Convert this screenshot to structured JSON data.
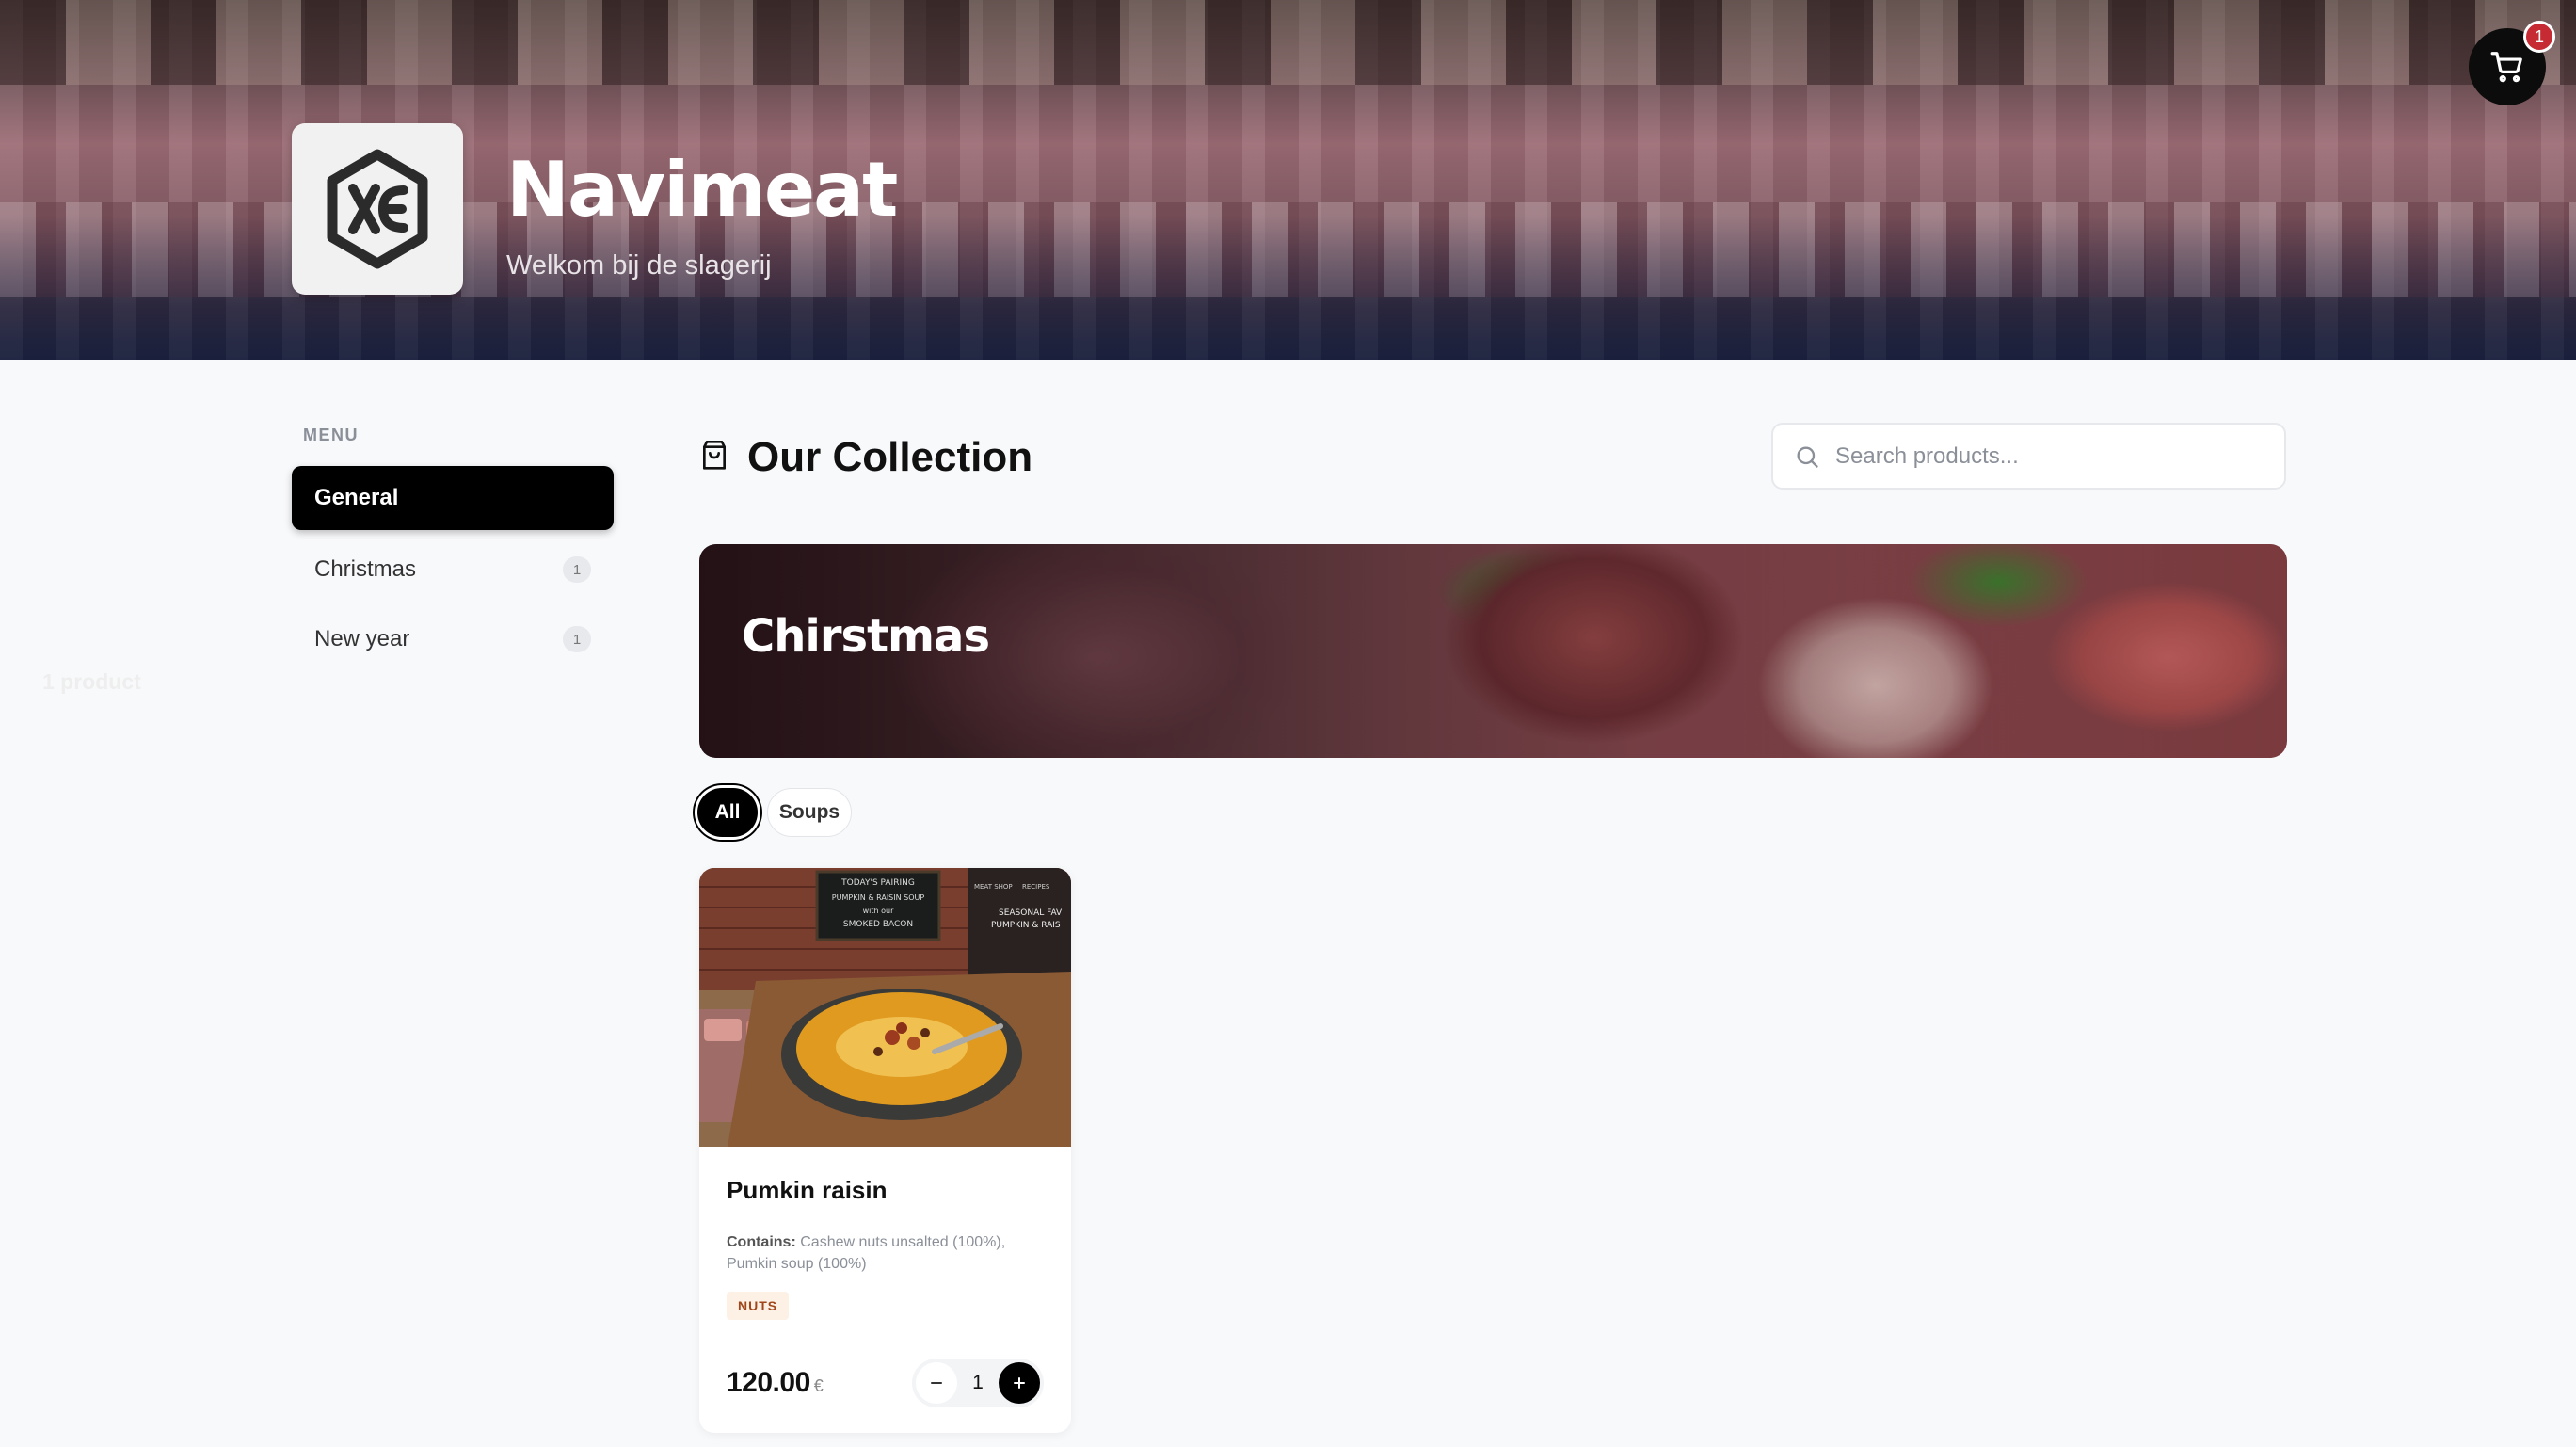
{
  "header": {
    "brand_name": "Navimeat",
    "tagline": "Welkom bij de slagerij",
    "cart_count": "1",
    "logo_icon": "hexagon-logo-icon"
  },
  "sidebar": {
    "label": "MENU",
    "items": [
      {
        "label": "General",
        "count": null,
        "active": true
      },
      {
        "label": "Christmas",
        "count": "1",
        "active": false
      },
      {
        "label": "New year",
        "count": "1",
        "active": false
      }
    ]
  },
  "main": {
    "title": "Our Collection",
    "title_icon": "shopping-bag-icon",
    "search": {
      "placeholder": "Search products...",
      "value": ""
    },
    "banner": {
      "title": "Chirstmas",
      "subtitle": "1 product"
    },
    "filters": [
      {
        "label": "All",
        "active": true
      },
      {
        "label": "Soups",
        "active": false
      }
    ]
  },
  "products": [
    {
      "name": "Pumkin raisin",
      "contains_label": "Contains:",
      "contains_text": "Cashew nuts unsalted (100%), Pumkin soup (100%)",
      "tags": [
        "NUTS"
      ],
      "price": "120.00",
      "currency": "€",
      "quantity": "1",
      "image_texts": {
        "board_line1": "TODAY'S PAIRING",
        "board_line2": "PUMPKIN & RAISIN SOUP",
        "board_line3": "with our",
        "board_line4": "SMOKED BACON",
        "side_nav1": "MEAT SHOP",
        "side_nav2": "RECIPES",
        "side_line1": "SEASONAL FAV",
        "side_line2": "PUMPKIN & RAIS"
      }
    }
  ],
  "colors": {
    "accent": "#000000",
    "badge": "#c62a32",
    "tag_bg": "#fdf0e4",
    "tag_text": "#a0461a",
    "page_bg": "#f8f9fb"
  }
}
